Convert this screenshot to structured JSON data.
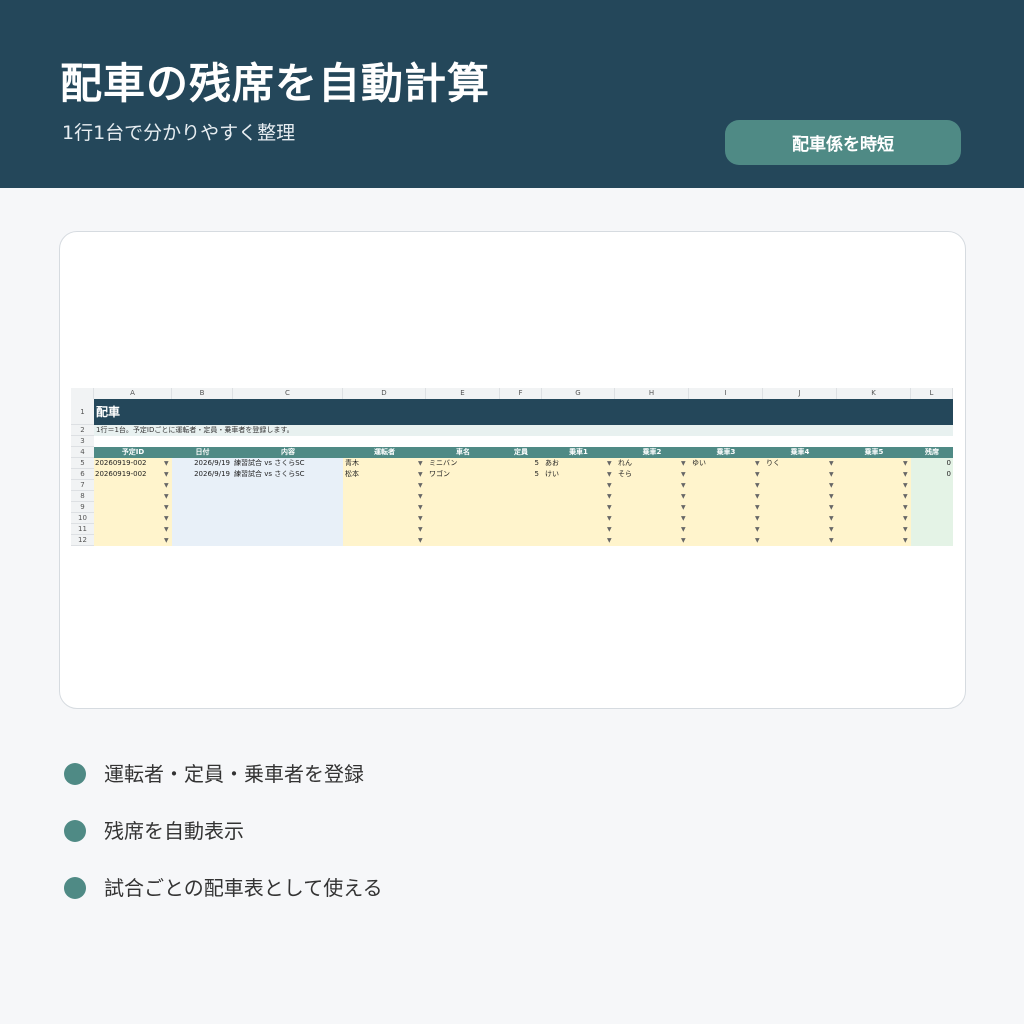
{
  "header": {
    "title": "配車の残席を自動計算",
    "subtitle": "1行1台で分かりやすく整理",
    "badge": "配車係を時短"
  },
  "sheet": {
    "columns": [
      "A",
      "B",
      "C",
      "D",
      "E",
      "F",
      "G",
      "H",
      "I",
      "J",
      "K",
      "L"
    ],
    "row_numbers": [
      "1",
      "2",
      "3",
      "4",
      "5",
      "6",
      "7",
      "8",
      "9",
      "10",
      "11",
      "12"
    ],
    "title": "配車",
    "note": "1行＝1台。予定IDごとに運転者・定員・乗車者を登録します。",
    "headers": [
      "予定ID",
      "日付",
      "内容",
      "運転者",
      "車名",
      "定員",
      "乗車1",
      "乗車2",
      "乗車3",
      "乗車4",
      "乗車5",
      "残席"
    ],
    "rows": [
      [
        "20260919-002",
        "2026/9/19",
        "練習試合 vs さくらSC",
        "青木",
        "ミニバン",
        "5",
        "あお",
        "れん",
        "ゆい",
        "りく",
        "",
        "0"
      ],
      [
        "20260919-002",
        "2026/9/19",
        "練習試合 vs さくらSC",
        "松本",
        "ワゴン",
        "5",
        "けい",
        "そら",
        "",
        "",
        "",
        "0"
      ]
    ],
    "dropdown_arrow": "▼"
  },
  "bullets": [
    "運転者・定員・乗車者を登録",
    "残席を自動表示",
    "試合ごとの配車表として使える"
  ],
  "colors": {
    "header_bg": "#24475a",
    "accent": "#4f8a85",
    "input_yellow": "#fff4cc",
    "lookup_blue": "#e8f0f8",
    "result_green": "#e4f3e6"
  }
}
